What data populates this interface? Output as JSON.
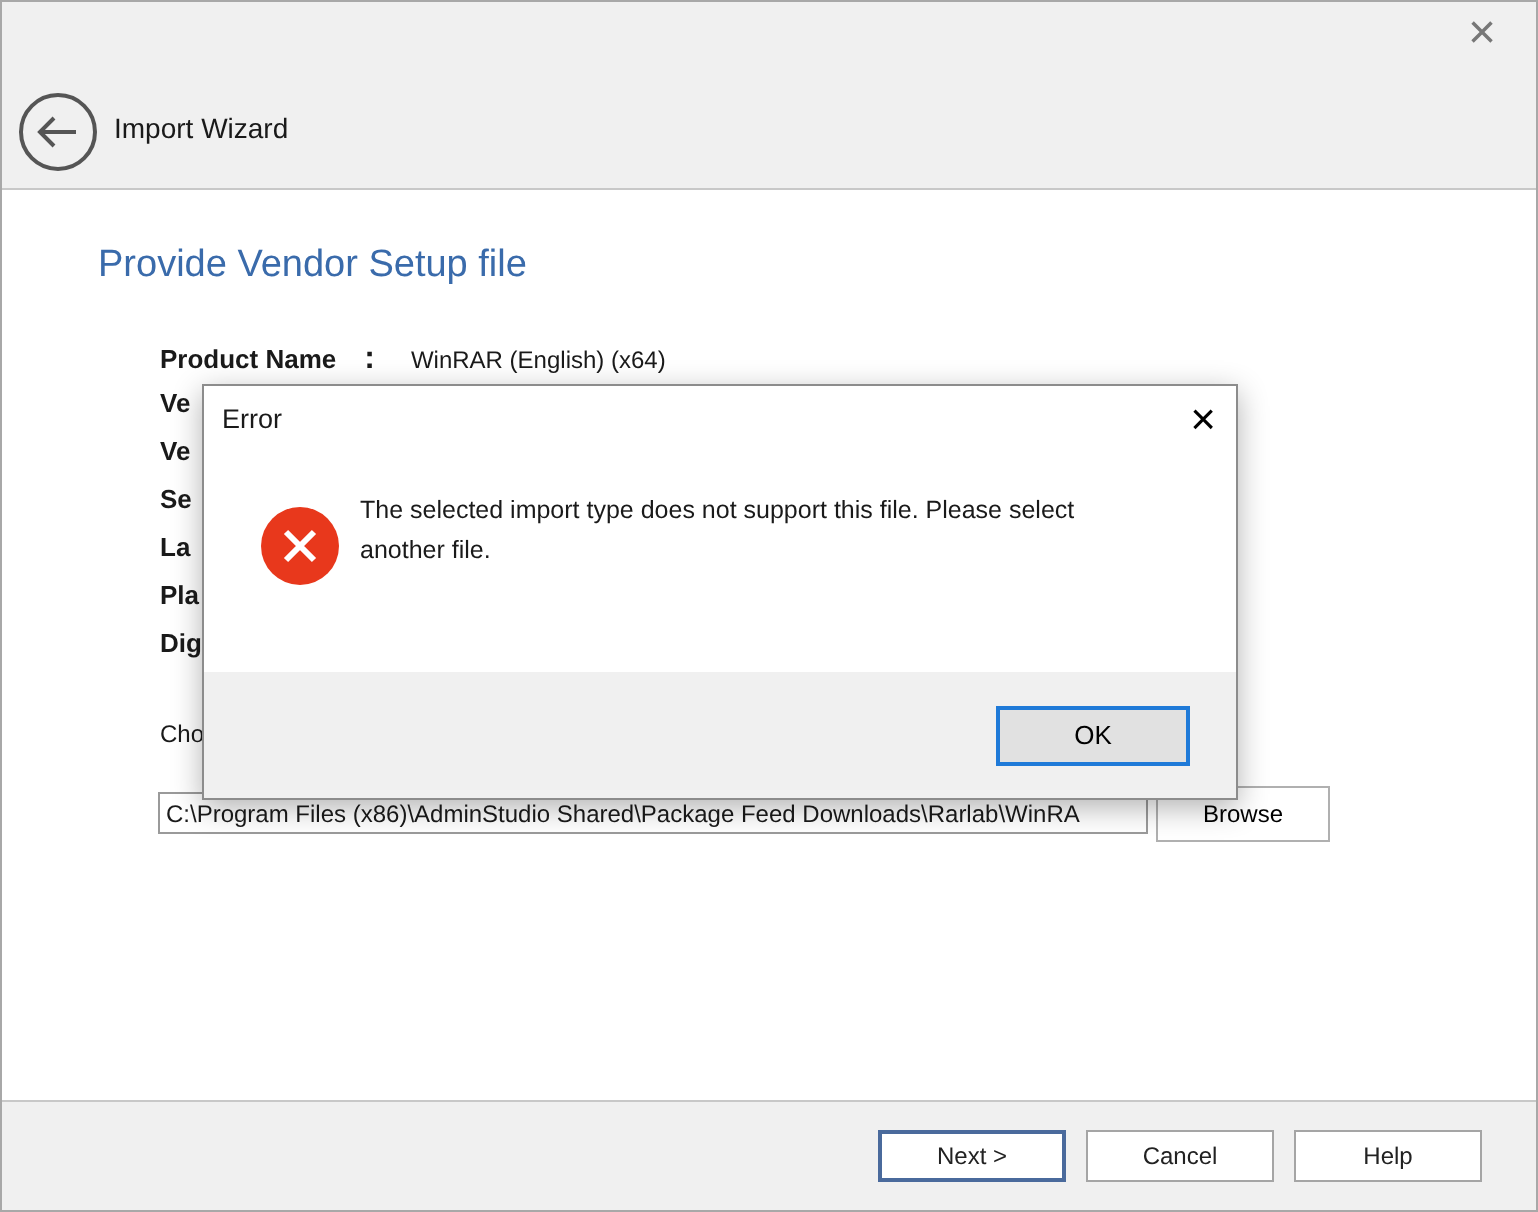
{
  "window": {
    "title": "Import Wizard",
    "close": "×"
  },
  "page": {
    "heading": "Provide Vendor Setup file",
    "fields": [
      {
        "label": "Product Name",
        "colon": ":",
        "value": "WinRAR (English) (x64)"
      },
      {
        "label": "Ve"
      },
      {
        "label": "Ve"
      },
      {
        "label": "Se"
      },
      {
        "label": "La"
      },
      {
        "label": "Pla"
      },
      {
        "label": "Dig"
      }
    ],
    "choose_label": "Cho",
    "path": {
      "value": "C:\\Program Files (x86)\\AdminStudio Shared\\Package Feed Downloads\\Rarlab\\WinRA"
    },
    "browse": "Browse"
  },
  "footer": {
    "buttons": [
      {
        "label": "Next >",
        "default": true
      },
      {
        "label": "Cancel",
        "default": false
      },
      {
        "label": "Help",
        "default": false
      }
    ]
  },
  "dialog": {
    "title": "Error",
    "close": "×",
    "message": "The selected import type does not support this file. Please select another file.",
    "ok": "OK"
  }
}
